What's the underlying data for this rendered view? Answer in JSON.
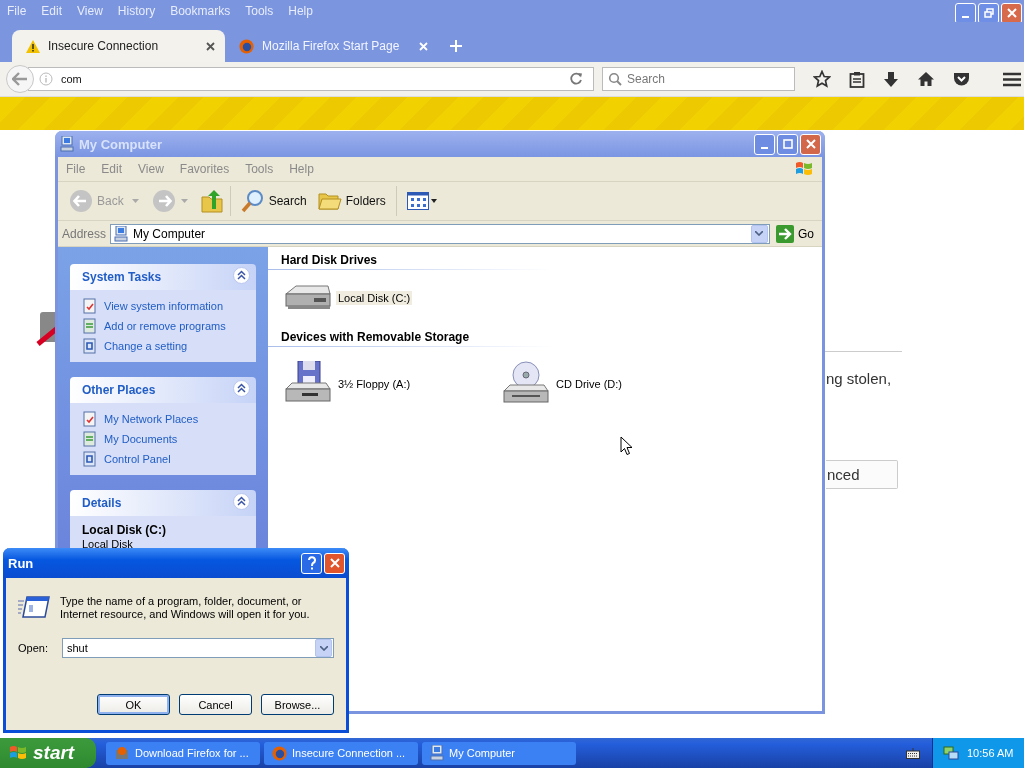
{
  "browser": {
    "menu": [
      "File",
      "Edit",
      "View",
      "History",
      "Bookmarks",
      "Tools",
      "Help"
    ],
    "tabs": [
      {
        "label": "Insecure Connection",
        "selected": true,
        "kind": "warning"
      },
      {
        "label": "Mozilla Firefox Start Page",
        "selected": false,
        "kind": "firefox"
      }
    ],
    "url": "com",
    "search": {
      "placeholder": "Search"
    },
    "page": {
      "text": "ng stolen,",
      "button": "nced"
    }
  },
  "explorer": {
    "title": "My Computer",
    "active": false,
    "menu": [
      "File",
      "Edit",
      "View",
      "Favorites",
      "Tools",
      "Help"
    ],
    "toolbar": {
      "back": "Back",
      "search": "Search",
      "folders": "Folders"
    },
    "address": {
      "label": "Address",
      "value": "My Computer",
      "go": "Go"
    },
    "panels": [
      {
        "title": "System Tasks",
        "expanded": true,
        "items": [
          "View system information",
          "Add or remove programs",
          "Change a setting"
        ]
      },
      {
        "title": "Other Places",
        "expanded": true,
        "items": [
          "My Network Places",
          "My Documents",
          "Control Panel"
        ]
      },
      {
        "title": "Details",
        "expanded": true,
        "name": "Local Disk (C:)",
        "type": "Local Disk"
      }
    ],
    "groups": [
      {
        "heading": "Hard Disk Drives",
        "items": [
          {
            "label": "Local Disk (C:)",
            "kind": "hdd",
            "selected": true
          }
        ]
      },
      {
        "heading": "Devices with Removable Storage",
        "items": [
          {
            "label": "3½ Floppy (A:)",
            "kind": "floppy",
            "selected": false
          },
          {
            "label": "CD Drive (D:)",
            "kind": "cd",
            "selected": false
          }
        ]
      }
    ]
  },
  "run": {
    "title": "Run",
    "active": true,
    "prompt": "Type the name of a program, folder, document, or Internet resource, and Windows will open it for you.",
    "open_label": "Open:",
    "value": "shut",
    "buttons": [
      {
        "label": "OK",
        "default": true
      },
      {
        "label": "Cancel",
        "default": false
      },
      {
        "label": "Browse...",
        "default": false
      }
    ]
  },
  "taskbar": {
    "start": "start",
    "tasks": [
      {
        "label": "Download Firefox for ...",
        "selected": false,
        "kind": "setup"
      },
      {
        "label": "Insecure Connection ...",
        "selected": false,
        "kind": "firefox"
      },
      {
        "label": "My Computer",
        "selected": false,
        "kind": "computer"
      }
    ],
    "clock": "10:56 AM"
  }
}
